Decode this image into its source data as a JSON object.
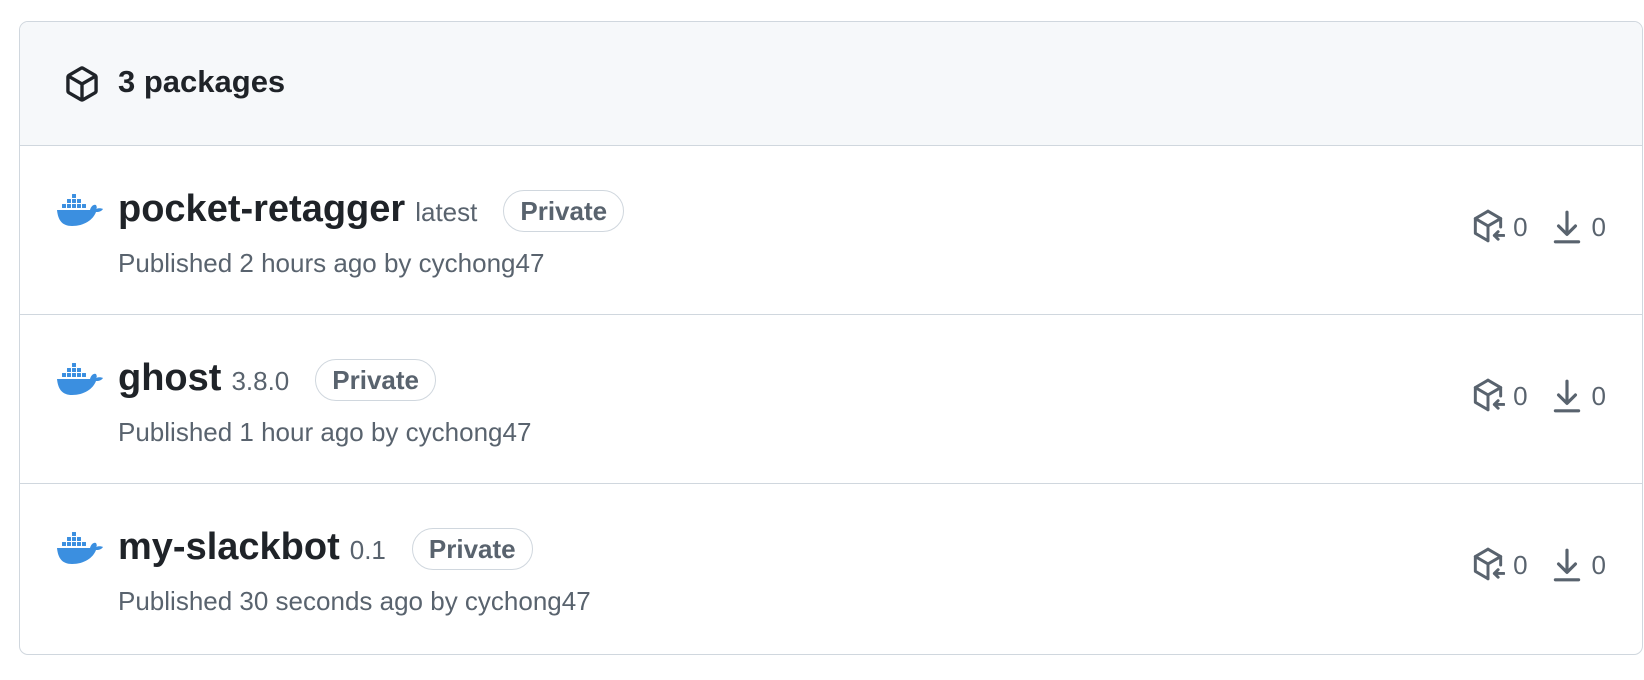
{
  "header": {
    "icon": "package-icon",
    "title": "3 packages"
  },
  "packages": [
    {
      "name": "pocket-retagger",
      "version": "latest",
      "visibility": "Private",
      "published": "Published 2 hours ago by cychong47",
      "dependents": "0",
      "downloads": "0",
      "icon": "docker-icon"
    },
    {
      "name": "ghost",
      "version": "3.8.0",
      "visibility": "Private",
      "published": "Published 1 hour ago by cychong47",
      "dependents": "0",
      "downloads": "0",
      "icon": "docker-icon"
    },
    {
      "name": "my-slackbot",
      "version": "0.1",
      "visibility": "Private",
      "published": "Published 30 seconds ago by cychong47",
      "dependents": "0",
      "downloads": "0",
      "icon": "docker-icon"
    }
  ],
  "colors": {
    "docker_blue": "#3b8fe0",
    "muted_text": "#59636e",
    "border": "#d0d7de",
    "header_bg": "#f6f8fa"
  }
}
